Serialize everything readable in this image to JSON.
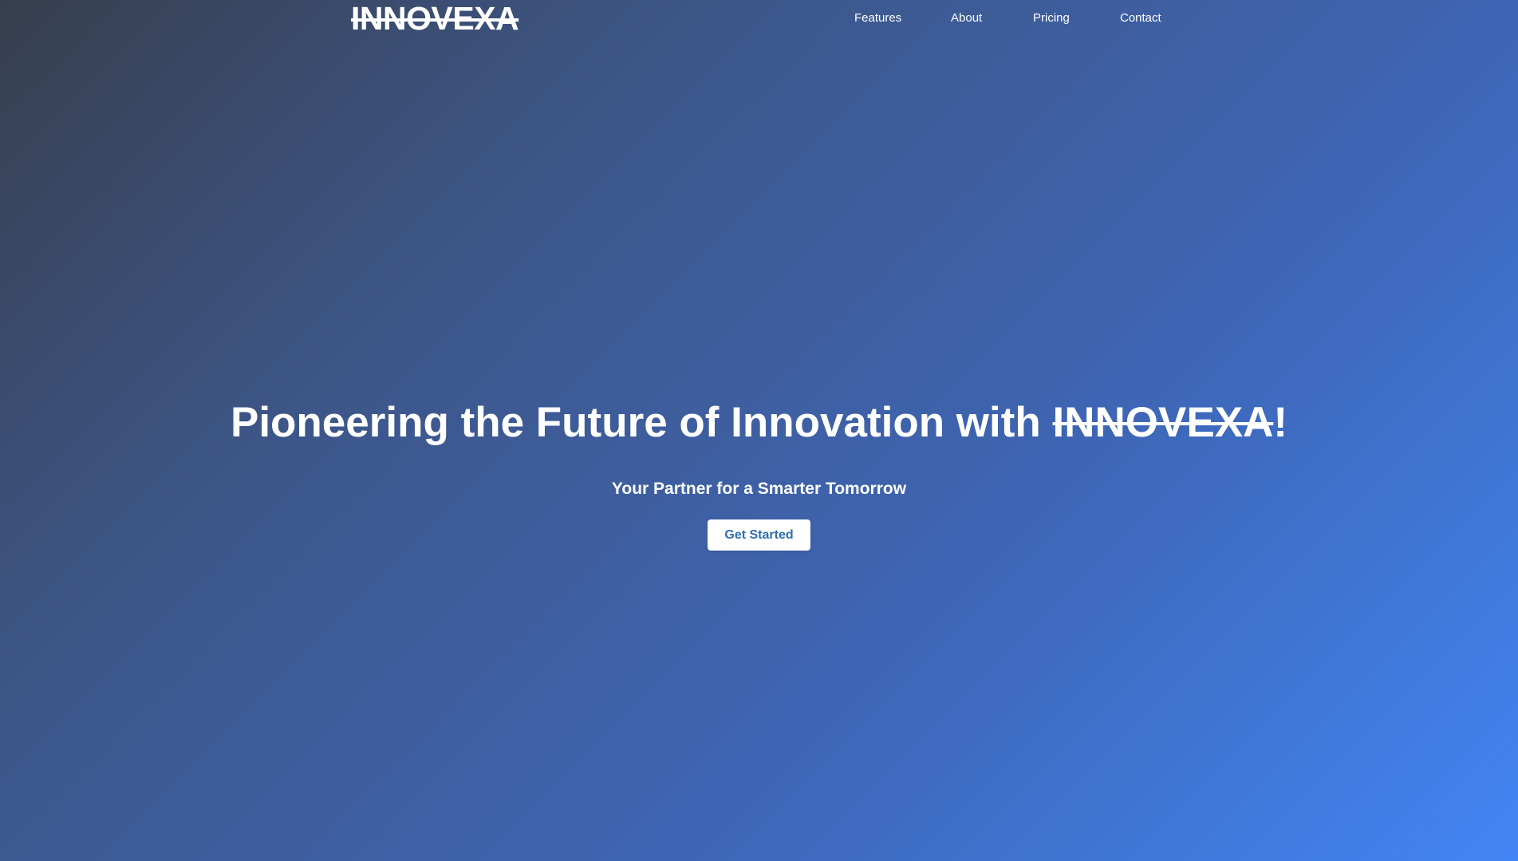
{
  "header": {
    "logo_text": "INNOVEXA",
    "nav": [
      {
        "label": "Features"
      },
      {
        "label": "About"
      },
      {
        "label": "Pricing"
      },
      {
        "label": "Contact"
      }
    ]
  },
  "hero": {
    "title_prefix": "Pioneering the Future of Innovation with ",
    "title_brand": "INNOVEXA",
    "title_suffix": "!",
    "subtitle": "Your Partner for a Smarter Tomorrow",
    "cta_label": "Get Started"
  },
  "colors": {
    "gradient_start": "#373f4e",
    "gradient_end": "#4285f4",
    "text": "#ffffff",
    "button_bg": "#ffffff",
    "button_text": "#2f6fb0"
  }
}
